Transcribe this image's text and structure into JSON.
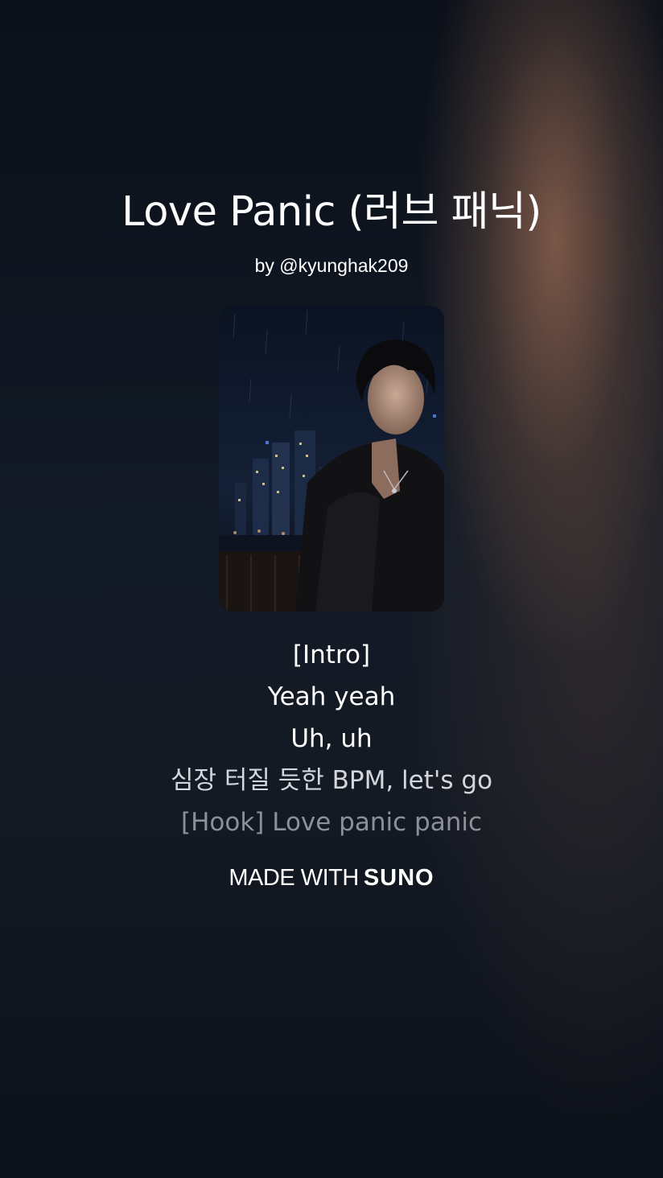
{
  "song": {
    "title": "Love Panic (러브 패닉)",
    "artist": "by @kyunghak209"
  },
  "cover_art": {
    "description_icon": "album-cover-image"
  },
  "lyrics": [
    "[Intro]",
    "Yeah yeah",
    "Uh, uh",
    "심장 터질 듯한 BPM, let's go",
    "[Hook] Love panic panic"
  ],
  "footer": {
    "made_with": "MADE WITH",
    "brand": "SUNO"
  },
  "colors": {
    "background": "#0e131c",
    "accent_glow": "#8c624e",
    "text": "#ffffff"
  }
}
